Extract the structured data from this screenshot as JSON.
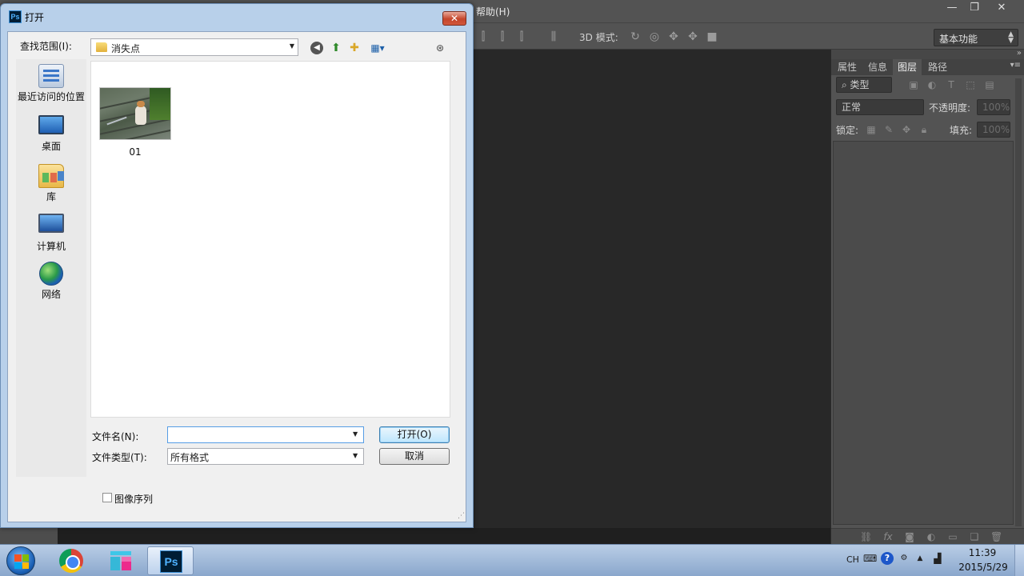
{
  "photoshop": {
    "menu_help": "帮助(H)",
    "options_3d_label": "3D 模式:",
    "workspace": "基本功能",
    "panel_tabs": [
      "属性",
      "信息",
      "图层",
      "路径"
    ],
    "active_tab": "图层",
    "filter_kind": "类型",
    "blend_mode": "正常",
    "opacity_label": "不透明度:",
    "opacity_value": "100%",
    "lock_label": "锁定:",
    "fill_label": "填充:",
    "fill_value": "100%"
  },
  "dialog": {
    "title": "打开",
    "app_icon_text": "Ps",
    "look_in_label": "查找范围(I):",
    "look_in_value": "消失点",
    "places": [
      "最近访问的位置",
      "桌面",
      "库",
      "计算机",
      "网络"
    ],
    "files": [
      {
        "name": "01"
      }
    ],
    "filename_label": "文件名(N):",
    "filename_value": "",
    "filetype_label": "文件类型(T):",
    "filetype_value": "所有格式",
    "open_button": "打开(O)",
    "cancel_button": "取消",
    "image_sequence_label": "图像序列",
    "image_sequence_checked": false
  },
  "taskbar": {
    "apps": [
      "start",
      "chrome",
      "app3",
      "photoshop"
    ],
    "active_app": "photoshop",
    "ps_icon_text": "Ps",
    "tray_language": "CH",
    "clock_time": "11:39",
    "clock_date": "2015/5/29"
  },
  "colors": {
    "ps_ui": "#535353",
    "ps_canvas": "#282828",
    "dialog_frame": "#b8d0ea",
    "taskbar": "#8aa7cc"
  }
}
